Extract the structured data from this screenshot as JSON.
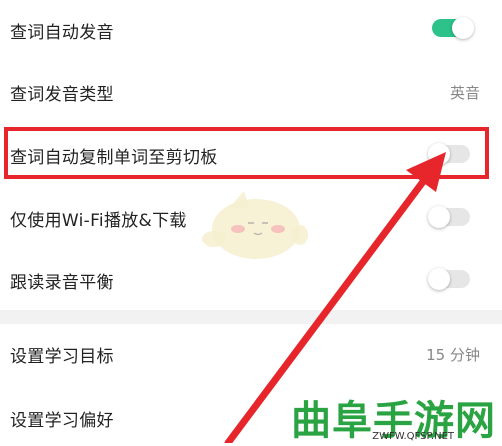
{
  "settings": {
    "auto_pronounce": {
      "label": "查词自动发音",
      "state": "on"
    },
    "pronounce_type": {
      "label": "查词发音类型",
      "value": "英音"
    },
    "auto_copy": {
      "label": "查词自动复制单词至剪切板",
      "state": "off"
    },
    "wifi_only": {
      "label": "仅使用Wi-Fi播放&下载",
      "state": "off"
    },
    "follow_read_balance": {
      "label": "跟读录音平衡",
      "state": "off"
    },
    "study_goal": {
      "label": "设置学习目标",
      "value": "15 分钟"
    },
    "study_pref": {
      "label": "设置学习偏好"
    }
  },
  "watermark": {
    "title": "曲阜手游网",
    "url": "ZWFW.QFSP.NET"
  },
  "colors": {
    "toggle_on": "#2cc28a",
    "highlight": "#e6262b",
    "watermark": "#2aa342"
  }
}
